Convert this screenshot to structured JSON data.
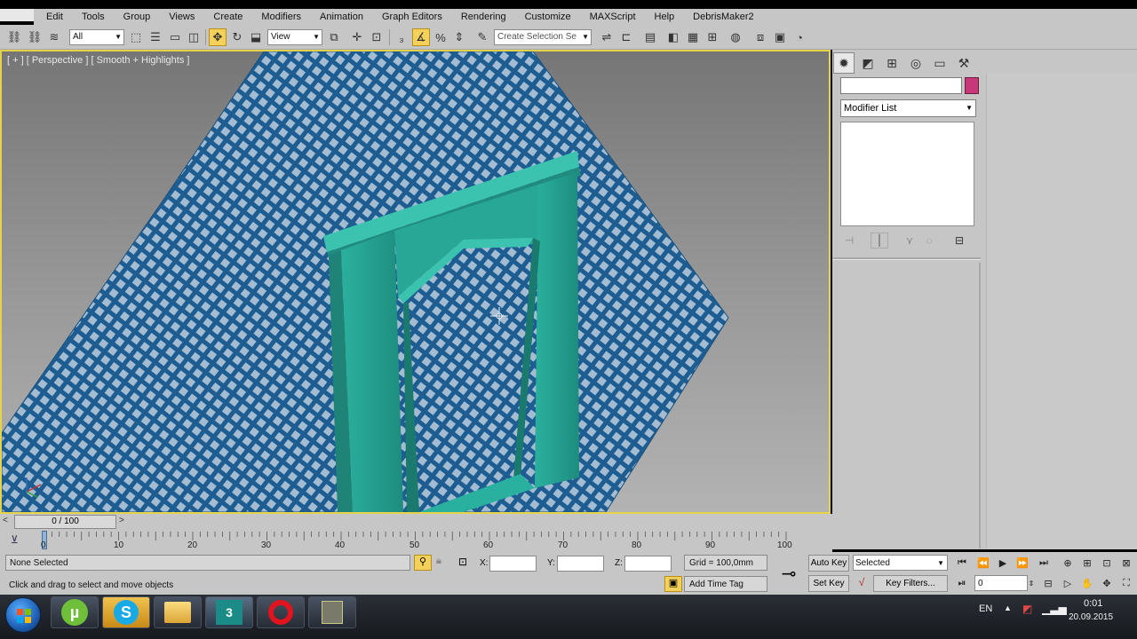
{
  "menubar": {
    "items": [
      "Edit",
      "Tools",
      "Group",
      "Views",
      "Create",
      "Modifiers",
      "Animation",
      "Graph Editors",
      "Rendering",
      "Customize",
      "MAXScript",
      "Help",
      "DebrisMaker2"
    ]
  },
  "toolbar": {
    "selection_filter": "All",
    "ref_coord": "View",
    "named_selection_placeholder": "Create Selection Se"
  },
  "viewport": {
    "label": "[ + ] [ Perspective ] [ Smooth + Highlights ]",
    "colors": {
      "border": "#e5d44a",
      "grid_object": "#1d5d92",
      "door_frame": "#2aa495"
    }
  },
  "command_panel": {
    "modifier_list": "Modifier List",
    "object_color": "#c83878"
  },
  "time_slider": {
    "position_label": "0 / 100",
    "left_arrow": "<",
    "right_arrow": ">"
  },
  "track_bar": {
    "frames": [
      "0",
      "10",
      "20",
      "30",
      "40",
      "50",
      "60",
      "70",
      "80",
      "90",
      "100"
    ]
  },
  "status": {
    "selection": "None Selected",
    "prompt": "Click and drag to select and move objects",
    "x_label": "X:",
    "y_label": "Y:",
    "z_label": "Z:",
    "grid": "Grid = 100,0mm",
    "add_time_tag": "Add Time Tag",
    "auto_key": "Auto Key",
    "set_key": "Set Key",
    "key_mode": "Selected",
    "key_filters": "Key Filters...",
    "current_frame": "0"
  },
  "taskbar": {
    "language": "EN",
    "time": "0:01",
    "date": "20.09.2015"
  }
}
